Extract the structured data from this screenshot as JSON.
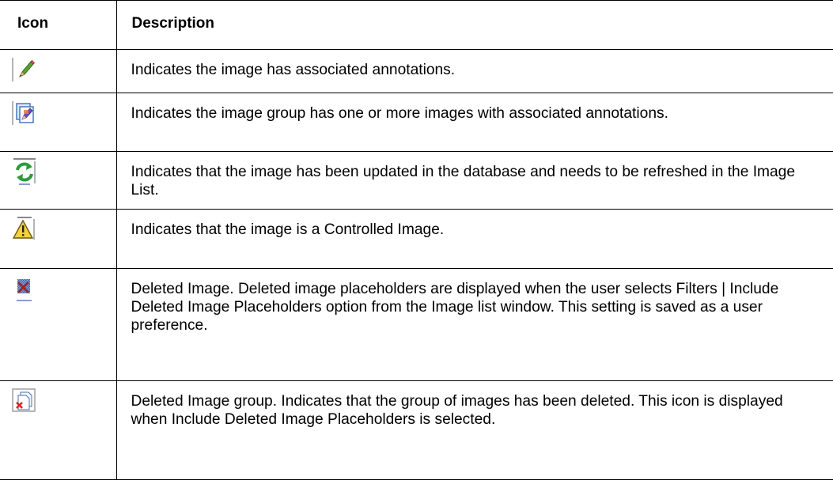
{
  "table": {
    "headers": {
      "icon": "Icon",
      "description": "Description"
    },
    "rows": [
      {
        "icon": "pencil-icon",
        "description": "Indicates the image has associated annotations."
      },
      {
        "icon": "image-group-annotation-icon",
        "description": "Indicates the image group has one or more images with associated annotations."
      },
      {
        "icon": "refresh-icon",
        "description": "Indicates that the image has been updated in the database and needs to be refreshed in the Image List."
      },
      {
        "icon": "warning-icon",
        "description": "Indicates that the image is a Controlled Image."
      },
      {
        "icon": "deleted-image-icon",
        "description": "Deleted Image. Deleted image placeholders are displayed when the user selects Filters | Include Deleted Image Placeholders option from the Image list window. This setting is saved as a user preference."
      },
      {
        "icon": "deleted-image-group-icon",
        "description": "Deleted Image group. Indicates that the group of images has been deleted. This icon is displayed when Include Deleted Image Placeholders is selected."
      }
    ]
  }
}
